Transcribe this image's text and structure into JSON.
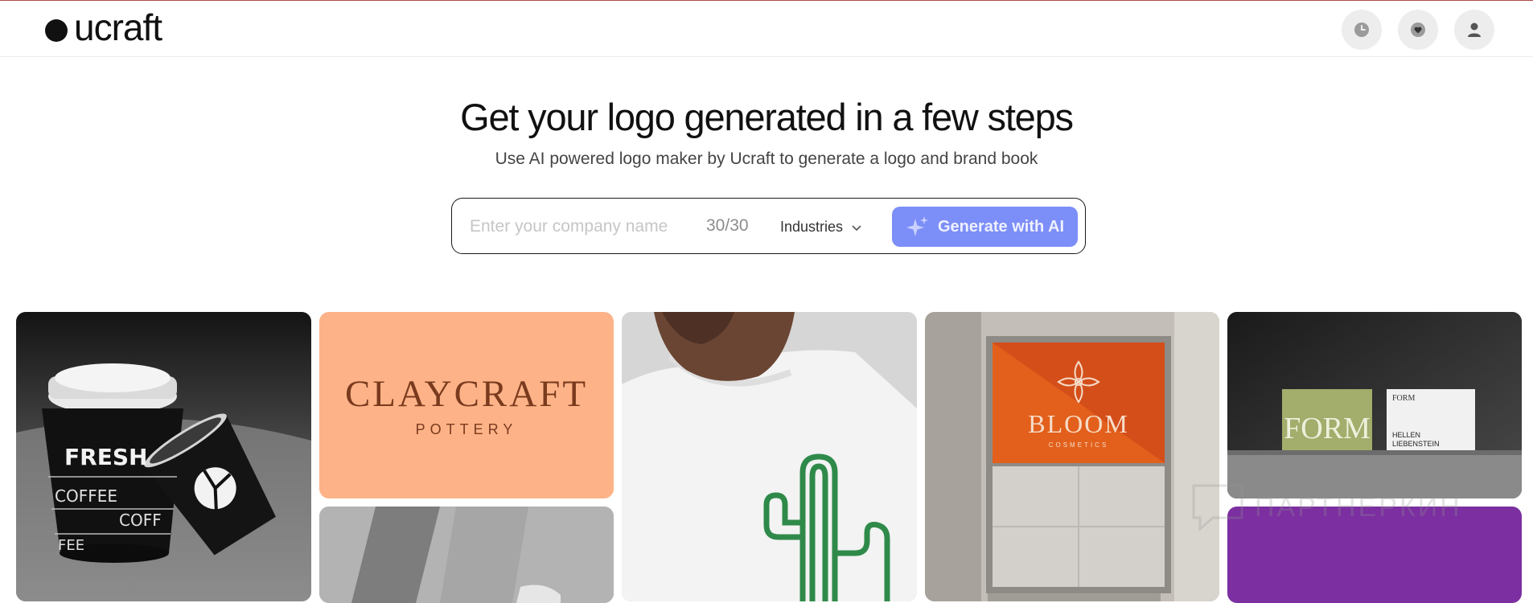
{
  "brand": {
    "name": "ucraft"
  },
  "header": {
    "buttons": [
      {
        "name": "history",
        "icon": "clock-icon"
      },
      {
        "name": "favorites",
        "icon": "heart-icon"
      },
      {
        "name": "account",
        "icon": "user-icon"
      }
    ]
  },
  "hero": {
    "title": "Get your logo generated in a few steps",
    "subtitle": "Use AI powered logo maker by Ucraft to generate a logo and brand book"
  },
  "form": {
    "company_placeholder": "Enter your company name",
    "company_value": "",
    "char_counter": "30/30",
    "industries_label": "Industries",
    "generate_label": "Generate with AI"
  },
  "gallery": {
    "fresh": {
      "brand": "FRESH",
      "line1": "COFFEE",
      "line2": "COFF",
      "line3": "FEE"
    },
    "claycraft": {
      "name": "CLAYCRAFT",
      "tag": "POTTERY"
    },
    "bloom": {
      "name": "BLOOM",
      "tag": "COSMETICS"
    },
    "form": {
      "name": "FORM",
      "small_name": "FORM",
      "person_first": "HELLEN",
      "person_last": "LIEBENSTEIN"
    }
  },
  "watermark": "ПАРТНЕРКИН",
  "colors": {
    "accent": "#7c8ef7",
    "claycraft_bg": "#fdb387",
    "claycraft_text": "#7a3a1e",
    "bloom_bg": "#e2601c",
    "purple": "#7b2fa0",
    "cactus": "#2f8a4a"
  }
}
